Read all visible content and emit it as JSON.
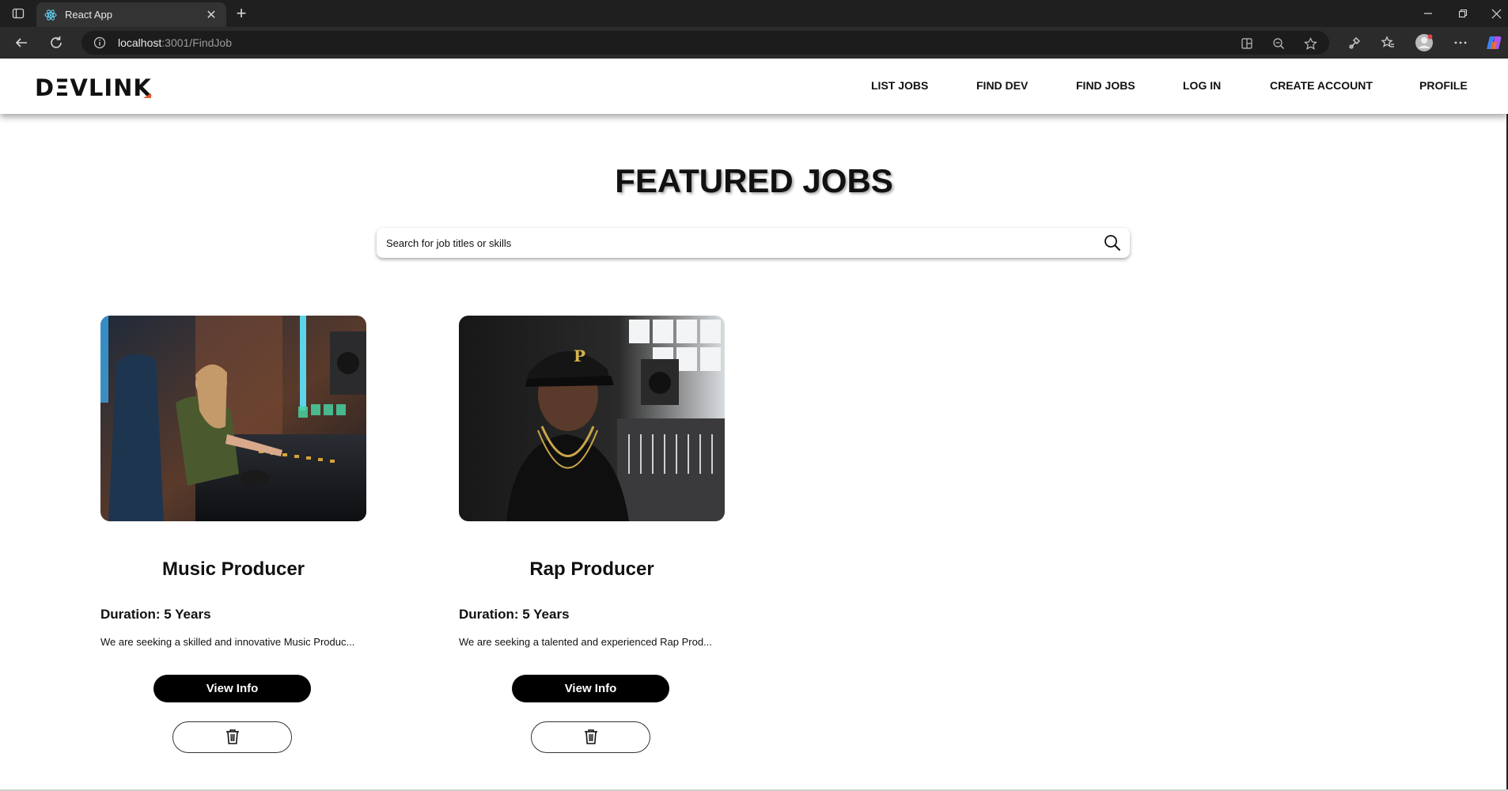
{
  "browser": {
    "tab_title": "React App",
    "url_host": "localhost",
    "url_rest": ":3001/FindJob",
    "icons": [
      "tab-list-icon",
      "react-favicon-icon",
      "close-icon",
      "plus-icon",
      "back-icon",
      "refresh-icon",
      "info-icon",
      "split-screen-icon",
      "zoom-out-icon",
      "star-icon",
      "extensions-icon",
      "favorites-icon",
      "avatar",
      "more-icon",
      "copilot-icon",
      "minimize-icon",
      "restore-icon",
      "close-window-icon"
    ]
  },
  "header": {
    "logo": {
      "before": "D",
      "slash": "Ξ",
      "after": "VLINK"
    },
    "nav": [
      "LIST JOBS",
      "FIND DEV",
      "FIND JOBS",
      "LOG IN",
      "CREATE ACCOUNT",
      "PROFILE"
    ]
  },
  "main": {
    "title": "FEATURED JOBS",
    "search": {
      "placeholder": "Search for job titles or skills"
    },
    "jobs": [
      {
        "title": "Music Producer",
        "duration": "Duration: 5 Years",
        "description": "We are seeking a skilled and innovative Music Produc...",
        "view_label": "View Info",
        "image": "woman-at-mixing-console-photo"
      },
      {
        "title": "Rap Producer",
        "duration": "Duration: 5 Years",
        "description": "We are seeking a talented and experienced Rap Prod...",
        "view_label": "View Info",
        "image": "man-in-cap-studio-photo"
      }
    ]
  },
  "colors": {
    "titlebar": "#1f1f1f",
    "toolbar": "#2b2b2b",
    "accent": "#e4572e",
    "button": "#000000"
  }
}
